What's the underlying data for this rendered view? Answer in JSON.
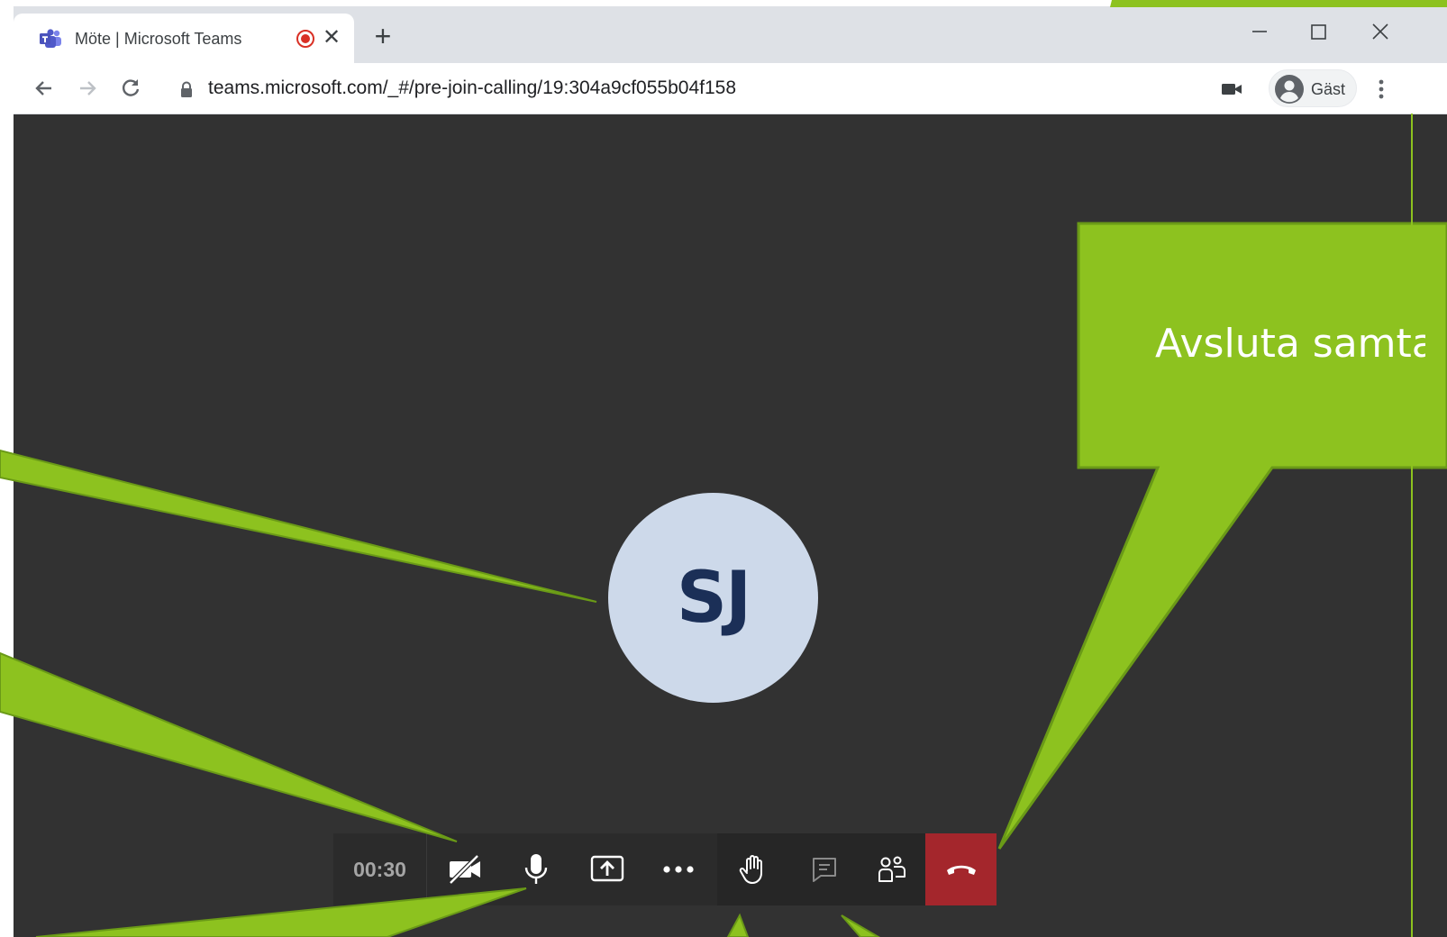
{
  "browser": {
    "tab_title": "Möte | Microsoft Teams",
    "url": "teams.microsoft.com/_#/pre-join-calling/19:304a9cf055b04f158",
    "profile_name": "Gäst",
    "icons": [
      "teams-favicon",
      "recording-icon",
      "close-icon",
      "plus-icon",
      "minimize-icon",
      "maximize-icon",
      "close-window-icon",
      "back-icon",
      "forward-icon",
      "reload-icon",
      "lock-icon",
      "camera-indicator-icon",
      "profile-avatar-icon",
      "kebab-menu-icon"
    ]
  },
  "meeting": {
    "participant_initials": "SJ",
    "call_timer": "00:30",
    "controls": [
      {
        "name": "camera-off",
        "icon": "camera-off-icon"
      },
      {
        "name": "microphone",
        "icon": "microphone-icon"
      },
      {
        "name": "share-screen",
        "icon": "share-screen-icon"
      },
      {
        "name": "more-actions",
        "icon": "more-icon"
      },
      {
        "name": "raise-hand",
        "icon": "hand-icon"
      },
      {
        "name": "chat",
        "icon": "chat-icon"
      },
      {
        "name": "participants",
        "icon": "participants-icon"
      },
      {
        "name": "hang-up",
        "icon": "hang-up-icon"
      }
    ]
  },
  "annotation": {
    "callout_text": "Avsluta samta",
    "callout_color": "#8dc21f",
    "callout_border": "#6a9a17"
  },
  "colors": {
    "stage_bg": "#323232",
    "callbar_bg": "#2b2b2b",
    "hangup_bg": "#a4262c",
    "avatar_bg": "#cdd9ea",
    "avatar_text": "#1b2f57"
  }
}
